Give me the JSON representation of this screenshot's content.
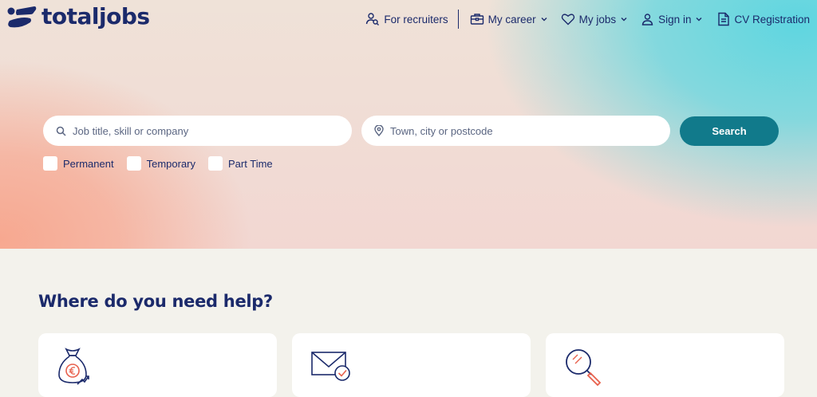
{
  "brand": {
    "name": "totaljobs"
  },
  "nav": {
    "recruiters_label": "For recruiters",
    "career_label": "My career",
    "jobs_label": "My jobs",
    "signin_label": "Sign in",
    "cv_label": "CV Registration"
  },
  "search": {
    "keyword_placeholder": "Job title, skill or company",
    "keyword_value": "",
    "location_placeholder": "Town, city or postcode",
    "location_value": "",
    "button_label": "Search"
  },
  "filters": [
    "Permanent",
    "Temporary",
    "Part Time"
  ],
  "help": {
    "title": "Where do you need help?"
  },
  "colors": {
    "brand_navy": "#1b2a6b",
    "accent_teal": "#117a8b",
    "accent_coral": "#e8604c"
  },
  "icons": [
    "recruiter-icon",
    "briefcase-icon",
    "heart-icon",
    "user-icon",
    "document-icon",
    "search-icon",
    "location-pin-icon",
    "money-bag-icon",
    "envelope-check-icon",
    "magnifier-icon"
  ]
}
